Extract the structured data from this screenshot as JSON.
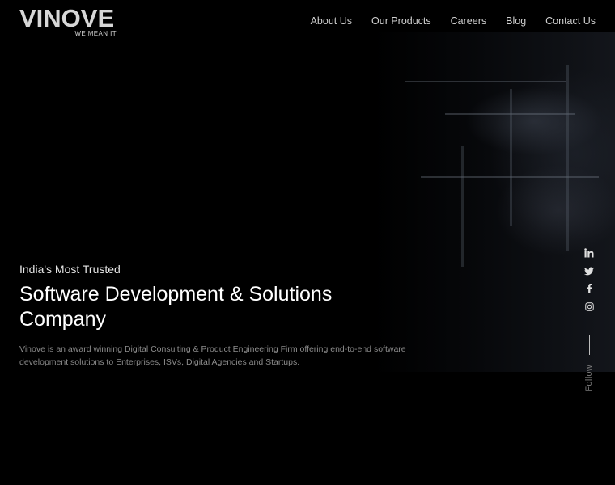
{
  "brand": {
    "name": "VINOVE",
    "tagline": "WE MEAN IT"
  },
  "nav": {
    "items": [
      {
        "label": "About Us"
      },
      {
        "label": "Our Products"
      },
      {
        "label": "Careers"
      },
      {
        "label": "Blog"
      },
      {
        "label": "Contact Us"
      }
    ]
  },
  "hero": {
    "eyebrow": "India's Most Trusted",
    "title_line1": "Software Development & Solutions",
    "title_line2": "Company",
    "description": "Vinove is an award winning Digital Consulting & Product Engineering Firm offering end-to-end software development solutions to Enterprises, ISVs, Digital Agencies and Startups."
  },
  "social": {
    "icons": [
      "linkedin-icon",
      "twitter-icon",
      "facebook-icon",
      "instagram-icon"
    ],
    "follow_label": "Follow"
  },
  "colors": {
    "background": "#000000",
    "text_primary": "#ffffff",
    "text_muted": "#8c8c8c"
  }
}
